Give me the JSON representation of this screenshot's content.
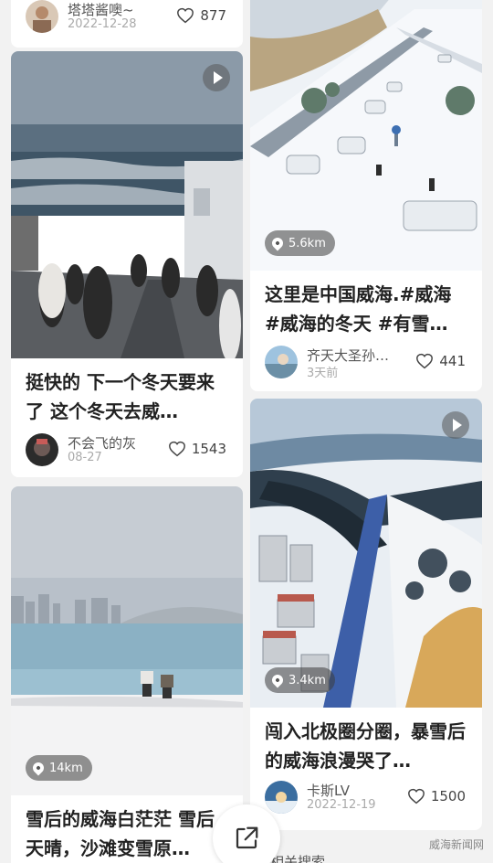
{
  "cards": [
    {
      "id": "c0",
      "title": "",
      "author": "塔塔酱噢~",
      "date": "2022-12-28",
      "likes": "877"
    },
    {
      "id": "c1",
      "title": "挺快的 下一个冬天要来了 这个冬天去威…",
      "author": "不会飞的灰",
      "date": "08-27",
      "likes": "1543",
      "has_play": true
    },
    {
      "id": "c2",
      "title": "这里是中国威海.#威海 #威海的冬天 #有雪…",
      "author": "齐天大圣孙…",
      "date": "3天前",
      "likes": "441",
      "distance": "5.6km"
    },
    {
      "id": "c3",
      "title": "闯入北极圈分圈，暴雪后的威海浪漫哭了…",
      "author": "卡斯LV",
      "date": "2022-12-19",
      "likes": "1500",
      "distance": "3.4km",
      "has_play": true
    },
    {
      "id": "c4",
      "title": "雪后的威海白茫茫 雪后天晴，沙滩变雪原…",
      "distance": "14km"
    }
  ],
  "fab": {
    "icon": "share-icon"
  },
  "related_label": "相关搜索",
  "watermark": "威海新闻网",
  "colors": {
    "background": "#f2f2f2",
    "card": "#ffffff",
    "text": "#222222",
    "muted": "#aaaaaa"
  }
}
